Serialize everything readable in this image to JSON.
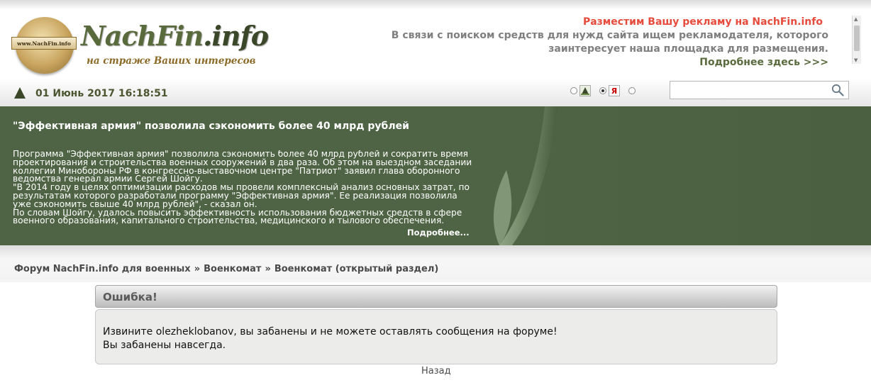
{
  "logo": {
    "title": "NachFin",
    "title_suffix": ".info",
    "tagline": "на страже Ваших интересов",
    "seal_text": "www.NachFin.info"
  },
  "ad": {
    "title": "Разместим Вашу рекламу на NachFin.info",
    "text": "В связи с поиском средств для нужд сайта ищем рекламодателя, которого заинтересует наша площадка для размещения.",
    "link": "Подробнее здесь >>>"
  },
  "date": "01 Июнь 2017 16:18:51",
  "search": {
    "engines": [
      {
        "name": "nachfin-search",
        "logo": "",
        "selected": false
      },
      {
        "name": "yandex-search",
        "logo": "Я",
        "selected": true
      },
      {
        "name": "google-search",
        "logo": "",
        "selected": false
      }
    ],
    "value": "",
    "placeholder": ""
  },
  "news": {
    "title": "\"Эффективная армия\" позволила сэкономить более 40 млрд рублей",
    "paragraphs": [
      "Программа \"Эффективная армия\" позволила сэкономить более 40 млрд рублей и сократить время проектирования и строительства военных сооружений в два раза. Об этом на выездном заседании коллегии Минобороны РФ в конгрессно-выставочном центре \"Патриот\" заявил глава оборонного ведомства генерал армии Сергей Шойгу.",
      "\"В 2014 году в целях оптимизации расходов мы провели комплексный анализ основных затрат, по результатам которого разработали программу \"Эффективная армия\". Ее реализация позволила уже сэкономить свыше 40 млрд рублей\", - сказал он.",
      "По словам Шойгу, удалось повысить эффективность использования бюджетных средств в сфере военного образования, капитального строительства, медицинского и тылового обеспечения."
    ],
    "more": "Подробнее..."
  },
  "breadcrumb": {
    "items": [
      "Форум NachFin.info для военных",
      "Военкомат",
      "Военкомат (открытый раздел)"
    ],
    "separator": "»"
  },
  "error": {
    "title": "Ошибка!",
    "line1": "Извините olezheklobanov, вы забанены и не можете оставлять сообщения на форуме!",
    "line2": "Вы забанены навсегда."
  },
  "back": "Назад",
  "colors": {
    "brand_green": "#4e6444",
    "ad_title_red": "#e74b3b",
    "logo_green": "#596b3c"
  }
}
